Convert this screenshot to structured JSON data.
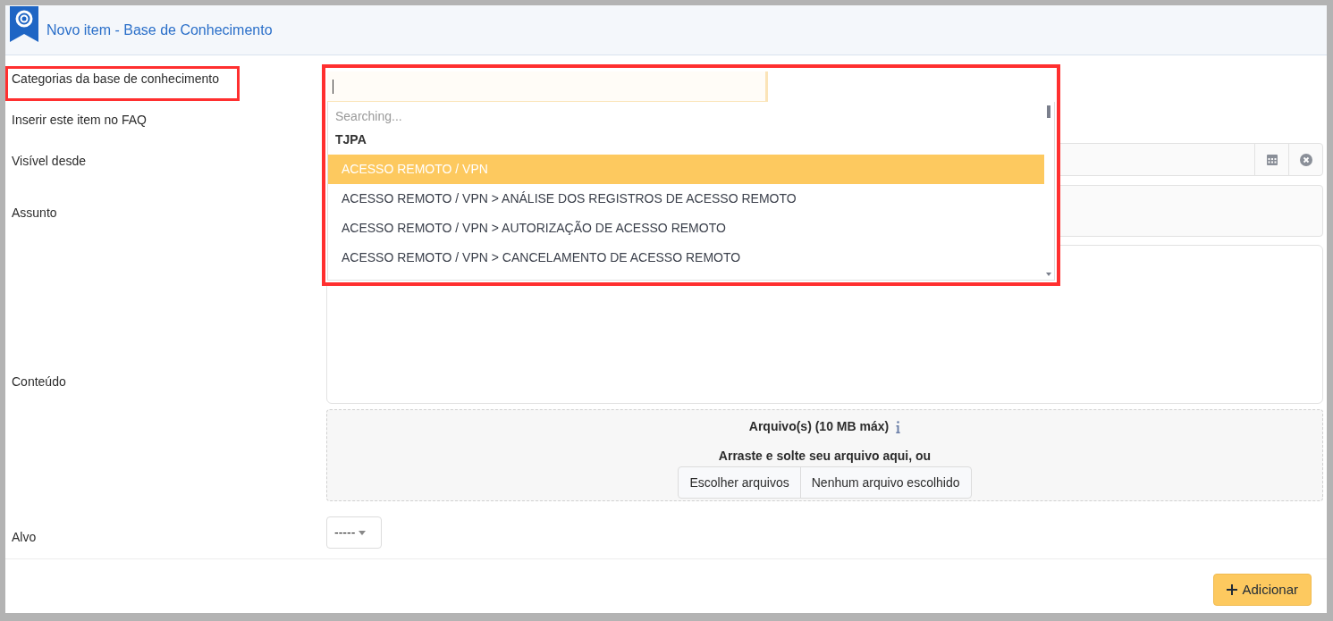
{
  "header": {
    "title": "Novo item - Base de Conhecimento"
  },
  "form": {
    "labels": [
      "Categorias da base de conhecimento",
      "Inserir este item no FAQ",
      "Visível desde",
      "Assunto",
      "Conteúdo",
      "Alvo"
    ]
  },
  "category_dropdown": {
    "searching": "Searching...",
    "group": "TJPA",
    "options": [
      {
        "label": "ACESSO REMOTO / VPN",
        "selected": true
      },
      {
        "label": "ACESSO REMOTO / VPN > ANÁLISE DOS REGISTROS DE ACESSO REMOTO",
        "selected": false
      },
      {
        "label": "ACESSO REMOTO / VPN > AUTORIZAÇÃO DE ACESSO REMOTO",
        "selected": false
      },
      {
        "label": "ACESSO REMOTO / VPN > CANCELAMENTO DE ACESSO REMOTO",
        "selected": false
      }
    ]
  },
  "upload": {
    "title": "Arquivo(s) (10 MB máx)",
    "hint": "Arraste e solte seu arquivo aqui, ou",
    "choose_button": "Escolher arquivos",
    "file_status": "Nenhum arquivo escolhido"
  },
  "target_select": {
    "value": "-----"
  },
  "submit_button": {
    "label": "Adicionar"
  }
}
